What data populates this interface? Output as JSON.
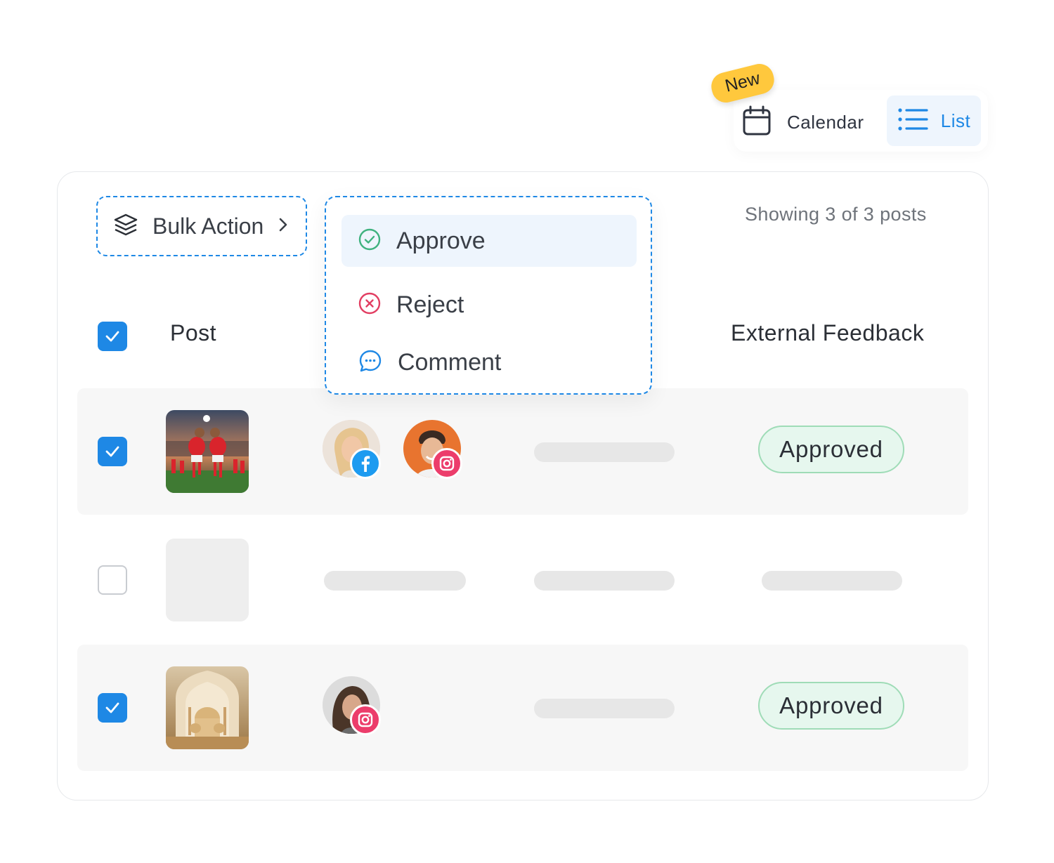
{
  "view_switcher": {
    "badge": "New",
    "calendar_label": "Calendar",
    "list_label": "List",
    "active": "List"
  },
  "toolbar": {
    "bulk_action_label": "Bulk Action",
    "showing_text": "Showing 3 of 3 posts"
  },
  "bulk_menu": {
    "items": [
      {
        "label": "Approve",
        "icon": "check-circle-icon",
        "color": "#3fb27f"
      },
      {
        "label": "Reject",
        "icon": "x-circle-icon",
        "color": "#e23e62"
      },
      {
        "label": "Comment",
        "icon": "chat-bubble-icon",
        "color": "#1e88e5"
      }
    ]
  },
  "table": {
    "headers": {
      "post": "Post",
      "external_feedback": "External Feedback"
    },
    "rows": [
      {
        "checked": true,
        "thumbnail": "soccer-players-image",
        "accounts": [
          {
            "network": "facebook"
          },
          {
            "network": "instagram"
          }
        ],
        "status": "Approved"
      },
      {
        "checked": false,
        "thumbnail": "placeholder",
        "accounts": [],
        "status": ""
      },
      {
        "checked": true,
        "thumbnail": "mosque-image",
        "accounts": [
          {
            "network": "instagram"
          }
        ],
        "status": "Approved"
      }
    ]
  },
  "colors": {
    "accent": "#1e88e5",
    "approved_bg": "#e6f7ee",
    "approved_border": "#9fdcb7",
    "badge": "#ffc83d",
    "facebook": "#1d9bf0",
    "instagram": "#ec3d6b"
  }
}
